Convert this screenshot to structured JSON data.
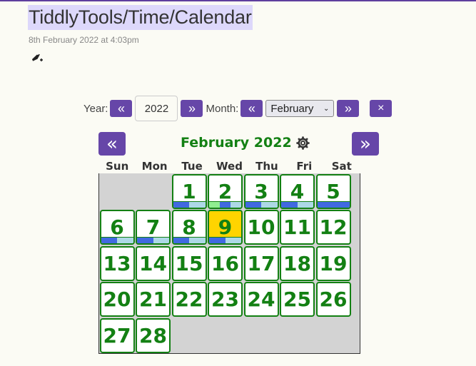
{
  "page": {
    "title": "TiddlyTools/Time/Calendar",
    "subtitle": "8th February 2022 at 4:03pm",
    "tag_icon": "tag-pen-icon"
  },
  "controls": {
    "year_label": "Year:",
    "year_value": "2022",
    "month_label": "Month:",
    "month_selected": "February",
    "prev_icon": "«",
    "next_icon": "»",
    "close_icon": "×"
  },
  "calendar": {
    "title": "February 2022",
    "settings_icon": "gear-icon",
    "prev_icon": "«",
    "next_icon": "»",
    "weekdays": [
      "Sun",
      "Mon",
      "Tue",
      "Wed",
      "Thu",
      "Fri",
      "Sat"
    ],
    "first_weekday_index": 2,
    "today": 9,
    "colors": {
      "blue": "#4169e1",
      "lightblue": "#add8e6",
      "lightgreen": "#90ee90",
      "accent": "#6646a8",
      "day_text": "#138013",
      "today_bg": "#ffd400"
    },
    "days": [
      {
        "day": "1",
        "bars": [
          "blue",
          "lightblue"
        ]
      },
      {
        "day": "2",
        "bars": [
          "lightgreen",
          "blue",
          "lightblue"
        ]
      },
      {
        "day": "3",
        "bars": [
          "blue",
          "lightblue"
        ]
      },
      {
        "day": "4",
        "bars": [
          "blue",
          "lightblue"
        ]
      },
      {
        "day": "5",
        "bars": [
          "blue"
        ]
      },
      {
        "day": "6",
        "bars": [
          "blue",
          "lightblue"
        ]
      },
      {
        "day": "7",
        "bars": [
          "blue",
          "lightblue"
        ]
      },
      {
        "day": "8",
        "bars": [
          "blue",
          "lightblue"
        ]
      },
      {
        "day": "9",
        "bars": [
          "blue",
          "lightblue"
        ]
      },
      {
        "day": "10",
        "bars": []
      },
      {
        "day": "11",
        "bars": []
      },
      {
        "day": "12",
        "bars": []
      },
      {
        "day": "13",
        "bars": []
      },
      {
        "day": "14",
        "bars": []
      },
      {
        "day": "15",
        "bars": []
      },
      {
        "day": "16",
        "bars": []
      },
      {
        "day": "17",
        "bars": []
      },
      {
        "day": "18",
        "bars": []
      },
      {
        "day": "19",
        "bars": []
      },
      {
        "day": "20",
        "bars": []
      },
      {
        "day": "21",
        "bars": []
      },
      {
        "day": "22",
        "bars": []
      },
      {
        "day": "23",
        "bars": []
      },
      {
        "day": "24",
        "bars": []
      },
      {
        "day": "25",
        "bars": []
      },
      {
        "day": "26",
        "bars": []
      },
      {
        "day": "27",
        "bars": []
      },
      {
        "day": "28",
        "bars": []
      }
    ]
  }
}
